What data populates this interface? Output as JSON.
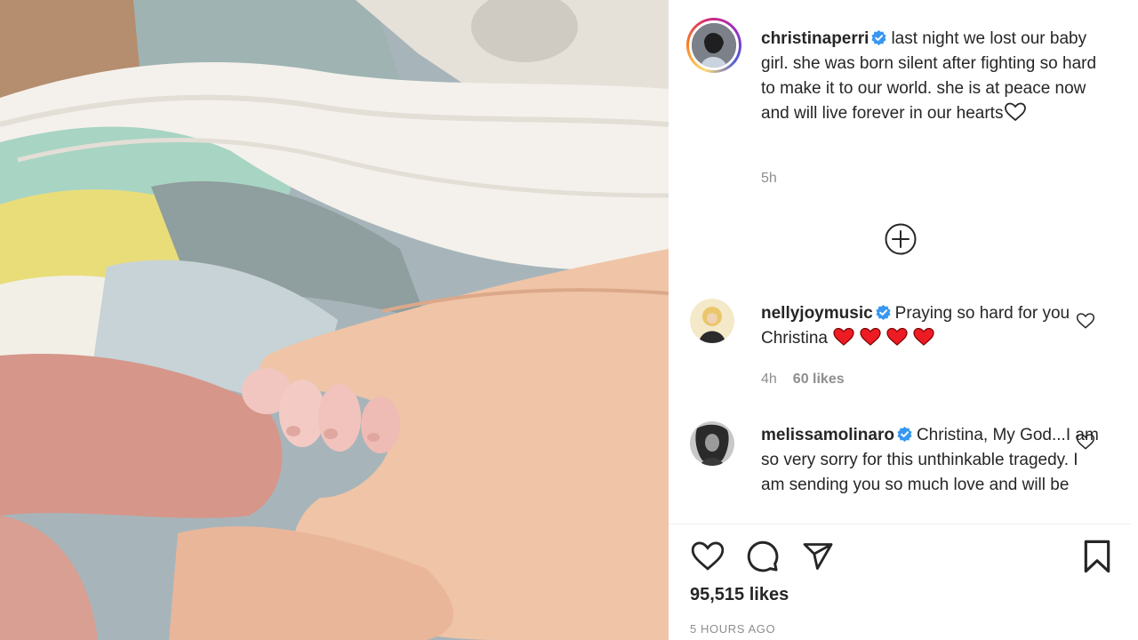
{
  "post": {
    "author": "christinaperri",
    "caption": "last night we lost our baby girl. she was born silent after fighting so hard to make it to our world. she is at peace now and will live forever in our hearts",
    "time": "5h"
  },
  "comments": [
    {
      "username": "nellyjoymusic",
      "text": "Praying so hard for you Christina",
      "time": "4h",
      "likes": "60 likes"
    },
    {
      "username": "melissamolinaro",
      "text": "Christina, My God...I am so very sorry for this unthinkable tragedy. I am sending you so much love and will be"
    }
  ],
  "footer": {
    "likes": "95,515 likes",
    "time_ago": "5 HOURS AGO"
  },
  "colors": {
    "verified": "#3897f0",
    "red_heart": "#ed1c24",
    "muted": "#8e8e8e"
  },
  "icons": [
    "verified-badge-icon",
    "heart-outline-icon",
    "plus-circle-icon",
    "comment-icon",
    "share-icon",
    "bookmark-icon",
    "red-heart-emoji-icon"
  ]
}
